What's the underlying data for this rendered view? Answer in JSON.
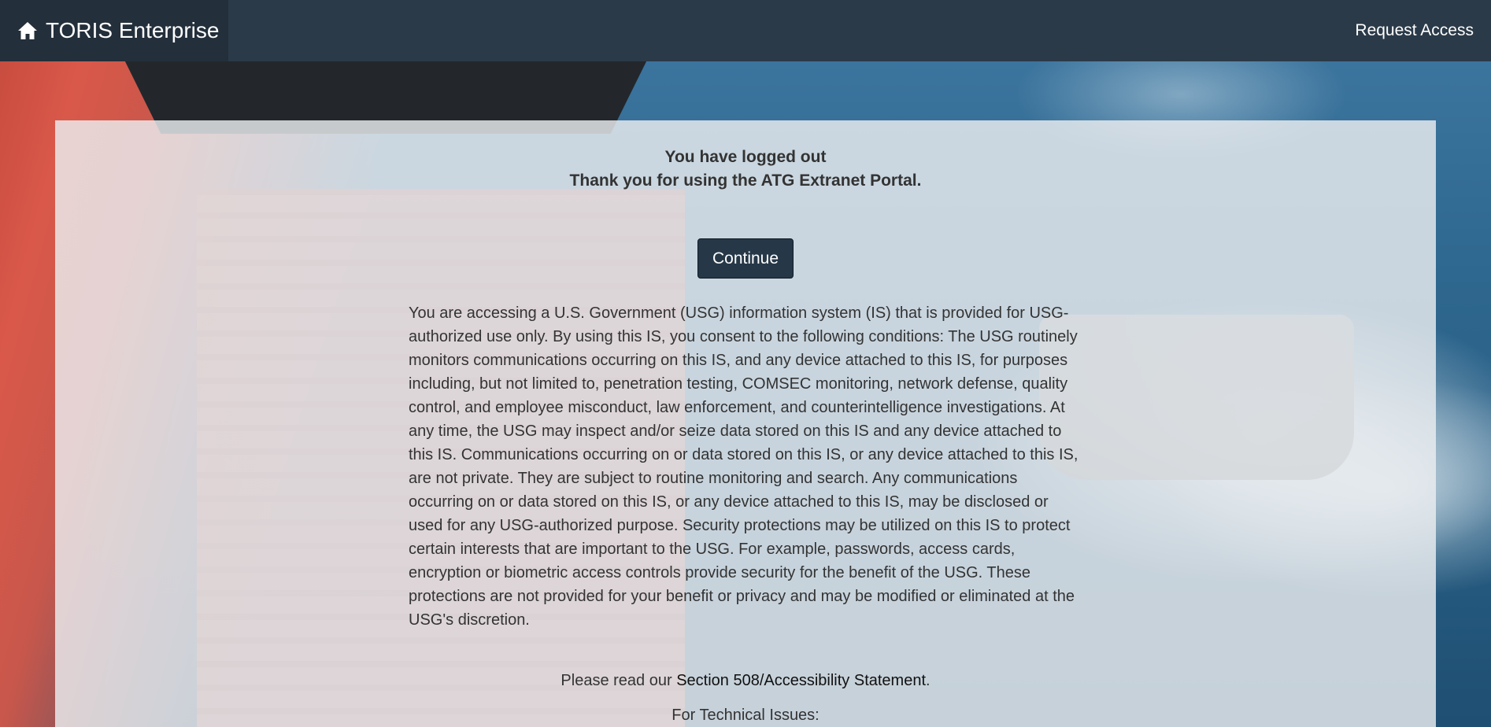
{
  "header": {
    "brand": "TORIS Enterprise",
    "brand_icon": "home-icon",
    "request_access": "Request Access"
  },
  "main": {
    "heading_line1": "You have logged out",
    "heading_line2": "Thank you for using the ATG Extranet Portal.",
    "continue_label": "Continue",
    "consent_text": "You are accessing a U.S. Government (USG) information system (IS) that is provided for USG-authorized use only. By using this IS, you consent to the following conditions: The USG routinely monitors communications occurring on this IS, and any device attached to this IS, for purposes including, but not limited to, penetration testing, COMSEC monitoring, network defense, quality control, and employee misconduct, law enforcement, and counterintelligence investigations. At any time, the USG may inspect and/or seize data stored on this IS and any device attached to this IS. Communications occurring on or data stored on this IS, or any device attached to this IS, are not private. They are subject to routine monitoring and search. Any communications occurring on or data stored on this IS, or any device attached to this IS, may be disclosed or used for any USG-authorized purpose. Security protections may be utilized on this IS to protect certain interests that are important to the USG. For example, passwords, access cards, encryption or biometric access controls provide security for the benefit of the USG. These protections are not provided for your benefit or privacy and may be modified or eliminated at the USG's discretion.",
    "accessibility_prefix": "Please read our ",
    "accessibility_link": "Section 508/Accessibility Statement",
    "accessibility_suffix": ".",
    "tech_issues": "For Technical Issues:"
  },
  "colors": {
    "navbar": "#2b3a48",
    "brand_bg": "#232f3a",
    "button": "#263848",
    "panel": "#eceef0"
  }
}
